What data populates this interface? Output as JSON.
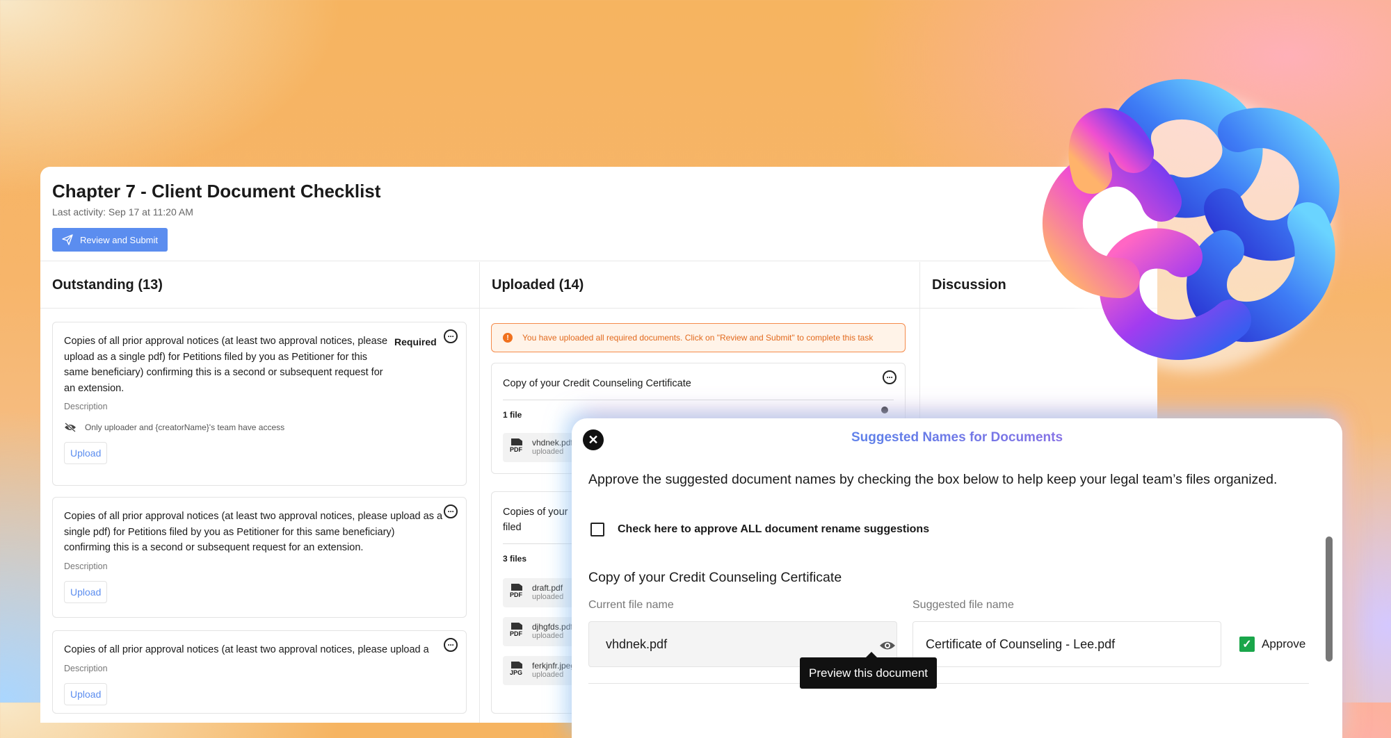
{
  "checklist": {
    "title": "Chapter 7 - Client Document Checklist",
    "last_activity": "Last activity: Sep 17 at 11:20 AM",
    "review_button": "Review and Submit"
  },
  "outstanding": {
    "heading": "Outstanding (13)",
    "items": [
      {
        "text": "Copies of all prior approval notices (at least two  approval notices, please upload as a single pdf)  for Petitions filed by you as Petitioner for this same beneficiary) confirming this is a second or subsequent request for an extension.",
        "required": "Required",
        "description": "Description",
        "access": "Only uploader and {creatorName}'s team have access",
        "upload": "Upload"
      },
      {
        "text": "Copies of all prior approval notices (at least two  approval notices, please upload as a single pdf)  for Petitions filed by you as Petitioner for this same beneficiary) confirming this is a second or subsequent request for an extension.",
        "description": "Description",
        "upload": "Upload"
      },
      {
        "text": "Copies of all prior approval notices (at least two  approval notices, please upload a",
        "description": "Description",
        "upload": "Upload"
      }
    ]
  },
  "uploaded": {
    "heading": "Uploaded (14)",
    "alert": "You have uploaded all required documents. Click on \"Review and Submit\" to complete this task",
    "cards": [
      {
        "title": "Copy of your Credit Counseling Certificate",
        "count": "1 file",
        "files": [
          {
            "type": "PDF",
            "name": "vhdnek.pdf",
            "sub": "uploaded"
          }
        ]
      },
      {
        "title": "Copies of your",
        "title2": "filed",
        "count": "3 files",
        "files": [
          {
            "type": "PDF",
            "name": "draft.pdf",
            "sub": "uploaded"
          },
          {
            "type": "PDF",
            "name": "djhgfds.pdf",
            "sub": "uploaded"
          },
          {
            "type": "JPG",
            "name": "ferkjnfr.jpeg",
            "sub": "uploaded"
          }
        ]
      }
    ]
  },
  "discussion": {
    "heading": "Discussion"
  },
  "modal": {
    "title": "Suggested Names for Documents",
    "intro": "Approve the suggested document names by checking the box below to help keep your legal team’s files organized.",
    "approve_all": "Check here to approve ALL document rename suggestions",
    "section_title": "Copy of your Credit Counseling Certificate",
    "current_label": "Current file name",
    "current_value": "vhdnek.pdf",
    "suggested_label": "Suggested file name",
    "suggested_value": "Certificate of Counseling - Lee.pdf",
    "approve_label": "Approve",
    "tooltip": "Preview this document"
  },
  "colors": {
    "primary": "#5b8def",
    "alert": "#f58a4a",
    "approve_green": "#1aa64a"
  },
  "icons": [
    "send-icon",
    "more-icon",
    "hidden-eye-icon",
    "info-icon",
    "pdf-file-icon",
    "jpg-file-icon",
    "close-icon",
    "eye-icon",
    "checkmark-icon"
  ]
}
